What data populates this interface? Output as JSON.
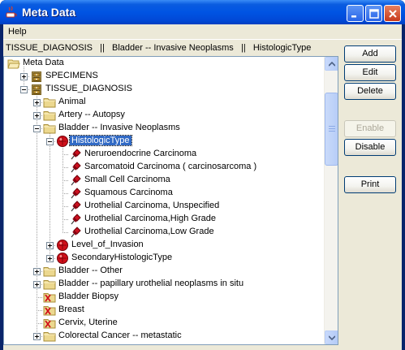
{
  "window": {
    "title": "Meta Data"
  },
  "menubar": {
    "items": [
      "Help"
    ]
  },
  "pathbar": {
    "text": "TISSUE_DIAGNOSIS   ||   Bladder -- Invasive Neoplasms   ||   HistologicType"
  },
  "tree": {
    "nodes": [
      {
        "label": "Meta Data",
        "icon": "open-folder-icon"
      },
      {
        "label": "SPECIMENS",
        "icon": "cabinet-icon"
      },
      {
        "label": "TISSUE_DIAGNOSIS",
        "icon": "cabinet-icon"
      },
      {
        "label": "Animal",
        "icon": "folder-icon"
      },
      {
        "label": "Artery -- Autopsy",
        "icon": "folder-icon"
      },
      {
        "label": "Bladder -- Invasive Neoplasms",
        "icon": "folder-icon"
      },
      {
        "label": "HistologicType",
        "icon": "red-ball-icon"
      },
      {
        "label": "Neruroendocrine Carcinoma",
        "icon": "pushpin-icon"
      },
      {
        "label": "Sarcomatoid Carcinoma ( carcinosarcoma )",
        "icon": "pushpin-icon"
      },
      {
        "label": "Small Cell Carcinoma",
        "icon": "pushpin-icon"
      },
      {
        "label": "Squamous Carcinoma",
        "icon": "pushpin-icon"
      },
      {
        "label": "Urothelial Carcinoma, Unspecified",
        "icon": "pushpin-icon"
      },
      {
        "label": "Urothelial Carcinoma,High Grade",
        "icon": "pushpin-icon"
      },
      {
        "label": "Urothelial Carcinoma,Low Grade",
        "icon": "pushpin-icon"
      },
      {
        "label": "Level_of_Invasion",
        "icon": "red-ball-icon"
      },
      {
        "label": "SecondaryHistologicType",
        "icon": "red-ball-icon"
      },
      {
        "label": "Bladder -- Other",
        "icon": "folder-icon"
      },
      {
        "label": "Bladder -- papillary urothelial neoplasms in situ",
        "icon": "folder-icon"
      },
      {
        "label": "Bladder Biopsy",
        "icon": "x-folder-icon"
      },
      {
        "label": "Breast",
        "icon": "x-folder-icon"
      },
      {
        "label": "Cervix, Uterine",
        "icon": "x-folder-icon"
      },
      {
        "label": "Colorectal Cancer -- metastatic",
        "icon": "folder-icon"
      }
    ]
  },
  "buttons": {
    "add": "Add",
    "edit": "Edit",
    "delete": "Delete",
    "enable": "Enable",
    "disable": "Disable",
    "print": "Print"
  },
  "colors": {
    "titlebar": "#0054e3",
    "selection": "#316ac5",
    "folder": "#e9d48b"
  }
}
